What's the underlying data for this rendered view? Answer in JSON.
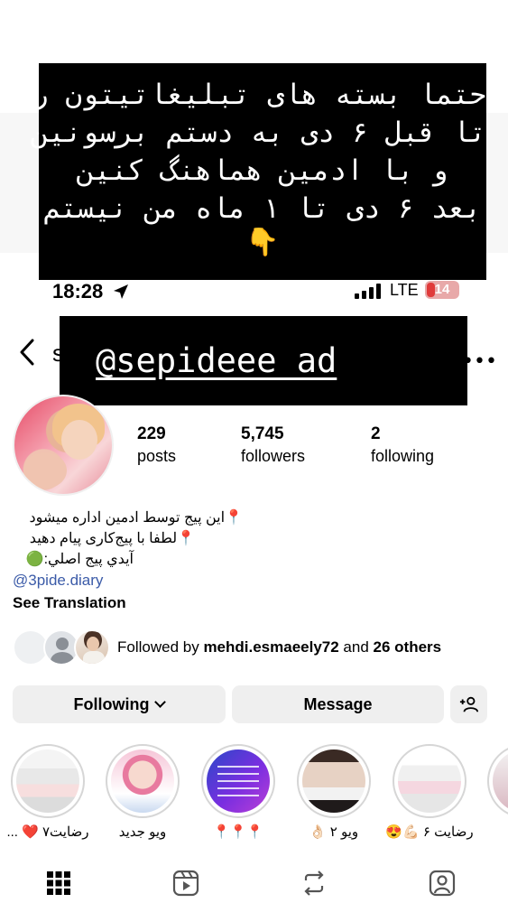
{
  "notice": {
    "lines": [
      "حتما بسته های تبلیغاتیتون رو",
      "تا قبل ۶ دی به دستم برسونین",
      "و با ادمین هماهنگ کنین",
      "بعد ۶ دی تا ۱ ماه من نیستم"
    ],
    "emoji": "👇"
  },
  "status_bar": {
    "time": "18:28",
    "network": "LTE",
    "battery": "14"
  },
  "header": {
    "peek_letter": "s",
    "handle_overlay": "@sepideee_ad"
  },
  "profile": {
    "stats": [
      {
        "value": "229",
        "label": "posts"
      },
      {
        "value": "5,745",
        "label": "followers"
      },
      {
        "value": "2",
        "label": "following"
      }
    ],
    "bio": {
      "line1": "📍این پیج توسط ادمین اداره میشود",
      "line2": "📍لطفا با پیج‌کاری پیام دهید",
      "line3": "آيدي پيج اصلي:🟢",
      "link": "@3pide.diary",
      "see_translation": "See Translation"
    },
    "followed_by": {
      "prefix": "Followed by ",
      "name": "mehdi.esmaeely72",
      "middle": " and ",
      "others": "26 others"
    }
  },
  "buttons": {
    "following": "Following",
    "message": "Message"
  },
  "highlights": [
    {
      "label": "رضایت۷ ❤️ ..."
    },
    {
      "label": "ویو جدید"
    },
    {
      "label": "📍📍📍"
    },
    {
      "label": "ویو ۲ 👌🏻"
    },
    {
      "label": "رضایت ۶ 💪🏻😍"
    },
    {
      "label": "🔥"
    }
  ],
  "colors": {
    "link": "#3b5ba8",
    "button_bg": "#efefef",
    "battery_low": "#e03b3b"
  },
  "icons": [
    "location-arrow-icon",
    "signal-icon",
    "battery-icon",
    "back-chevron-icon",
    "more-icon",
    "chevron-down-icon",
    "add-user-icon",
    "grid-icon",
    "reels-icon",
    "repost-icon",
    "tagged-icon"
  ]
}
